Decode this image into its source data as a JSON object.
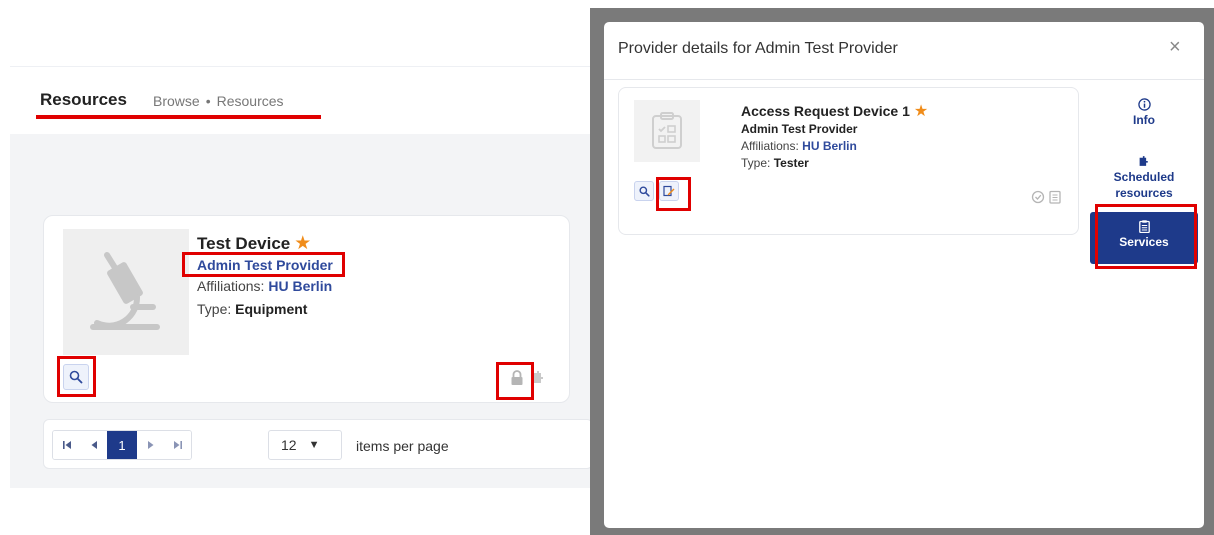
{
  "page": {
    "title": "Resources",
    "breadcrumb": [
      "Browse",
      "Resources"
    ],
    "breadcrumb_sep": "•"
  },
  "resource_card": {
    "title": "Test Device",
    "provider": "Admin Test Provider",
    "affiliations_label": "Affiliations:",
    "affiliations_value": "HU Berlin",
    "type_label": "Type:",
    "type_value": "Equipment",
    "favorite": true
  },
  "pager": {
    "current_page": "1",
    "per_page": "12",
    "per_page_label": "items per page"
  },
  "modal": {
    "title": "Provider details for Admin Test Provider",
    "close_glyph": "×",
    "card": {
      "title": "Access Request Device 1",
      "provider": "Admin Test Provider",
      "affiliations_label": "Affiliations:",
      "affiliations_value": "HU Berlin",
      "type_label": "Type:",
      "type_value": "Tester",
      "favorite": true
    },
    "sidebar": {
      "items": [
        {
          "label": "Info",
          "icon": "info-icon"
        },
        {
          "label": "Scheduled resources",
          "icon": "puzzle-icon"
        },
        {
          "label": "Services",
          "icon": "clipboard-icon",
          "active": true
        }
      ]
    }
  },
  "colors": {
    "accent": "#1e3a8a",
    "link": "#2f4a9c",
    "star": "#f08c1a",
    "highlight": "#e00000"
  }
}
